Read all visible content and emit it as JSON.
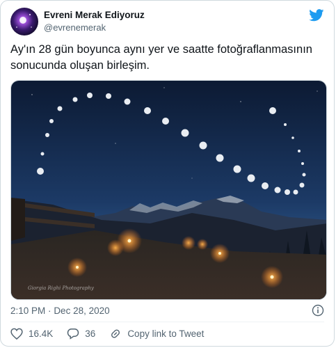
{
  "tweet": {
    "author_name": "Evreni Merak Ediyoruz",
    "author_handle": "@evrenemerak",
    "text_line1": "Ay'ın 28 gün boyunca aynı yer ve saatte fotoğraflanmasının",
    "text_line2": "sonucunda oluşan birleşim.",
    "time": "2:10 PM",
    "separator": "·",
    "date": "Dec 28, 2020",
    "likes": "16.4K",
    "replies": "36",
    "copy_link_label": "Copy link to Tweet",
    "photo_watermark": "Giorgia Righi Photography"
  },
  "icons": {
    "brand": "twitter-bird-icon",
    "info": "info-icon",
    "like": "heart-icon",
    "reply": "reply-icon",
    "link": "link-icon"
  },
  "colors": {
    "brand_blue": "#1d9bf0",
    "secondary_text": "#536471",
    "primary_text": "#0f1419"
  }
}
